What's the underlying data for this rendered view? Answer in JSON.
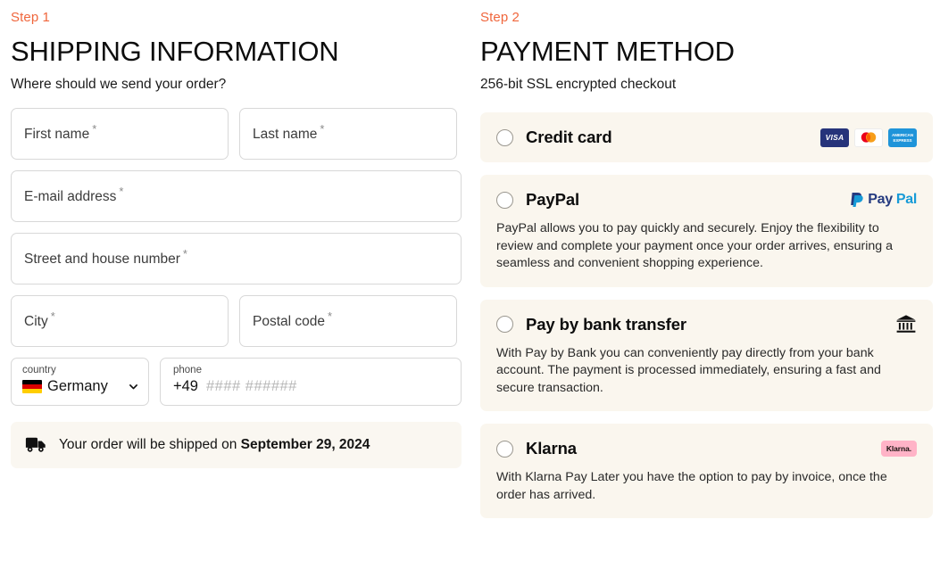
{
  "shipping": {
    "step_label": "Step 1",
    "title": "SHIPPING INFORMATION",
    "subtitle": "Where should we send your order?",
    "required_marker": "*",
    "fields": [
      {
        "label": "First name",
        "value": "",
        "required": true
      },
      {
        "label": "Last name",
        "value": "",
        "required": true
      },
      {
        "label": "E-mail address",
        "value": "",
        "required": true
      },
      {
        "label": "Street and house number",
        "value": "",
        "required": true
      },
      {
        "label": "City",
        "value": "",
        "required": true
      },
      {
        "label": "Postal code",
        "value": "",
        "required": true
      }
    ],
    "country": {
      "label": "country",
      "value": "Germany",
      "flag": "flag-de-icon",
      "chevron": "chevron-down-icon"
    },
    "phone": {
      "label": "phone",
      "prefix": "+49",
      "placeholder": "#### ######"
    },
    "notice": {
      "icon": "delivery-truck-icon",
      "text": "Your order will be shipped on ",
      "date": "September 29, 2024",
      "background": "#faf7f1"
    }
  },
  "payment": {
    "step_label": "Step 2",
    "title": "PAYMENT METHOD",
    "subtitle": "256-bit SSL encrypted checkout",
    "selected": null,
    "methods": [
      {
        "name": "Credit card",
        "description": "",
        "logos": [
          "visa-logo",
          "mastercard-logo",
          "amex-logo"
        ],
        "visa_text": "VISA",
        "amex_line1": "AMERICAN",
        "amex_line2": "EXPRESS"
      },
      {
        "name": "PayPal",
        "description": "PayPal allows you to pay quickly and securely. Enjoy the flexibility to review and complete your payment once your order arrives, ensuring a seamless and convenient shopping experience.",
        "logos": [
          "paypal-logo"
        ],
        "paypal_word_1": "Pay",
        "paypal_word_2": "Pal"
      },
      {
        "name": "Pay by bank transfer",
        "description": "With Pay by Bank you can conveniently pay directly from your bank account. The payment is processed immediately, ensuring a fast and secure transaction.",
        "logos": [
          "bank-icon"
        ]
      },
      {
        "name": "Klarna",
        "description": "With Klarna Pay Later you have the option to pay by invoice, once the order has arrived.",
        "logos": [
          "klarna-logo"
        ],
        "klarna_text": "Klarna."
      }
    ]
  },
  "colors": {
    "accent_step": "#f0663c",
    "card_background": "#faf6ee",
    "notice_background": "#faf7f1",
    "klarna_pink": "#ffb3c7",
    "paypal_dark": "#253b80",
    "paypal_light": "#179bd7",
    "visa_navy": "#26337a",
    "amex_blue": "#1f94d9"
  }
}
